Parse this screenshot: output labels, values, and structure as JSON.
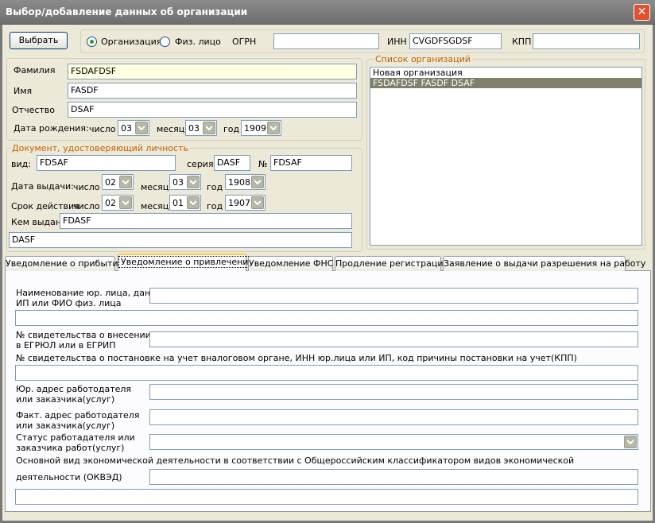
{
  "window": {
    "title": "Выбор/добавление данных об организации",
    "close": "✕"
  },
  "toolbar": {
    "select_button": "Выбрать",
    "radio_org": "Организация",
    "radio_person": "Физ. лицо",
    "ogrn_label": "ОГРН",
    "ogrn_value": "",
    "inn_label": "ИНН",
    "inn_value": "CVGDFSGDSF",
    "kpp_label": "КПП",
    "kpp_value": ""
  },
  "person": {
    "surname_label": "Фамилия",
    "surname_value": "FSDAFDSF",
    "name_label": "Имя",
    "name_value": "FASDF",
    "patronymic_label": "Отчество",
    "patronymic_value": "DSAF",
    "birth_label": "Дата рождения:",
    "day_label": "число",
    "day_value": "03",
    "month_label": "месяц",
    "month_value": "03",
    "year_label": "год",
    "year_value": "1909"
  },
  "org_list": {
    "legend": "Список организаций",
    "items": [
      "Новая организация",
      "FSDAFDSF FASDF DSAF"
    ]
  },
  "document": {
    "legend": "Документ, удостоверяющий личность",
    "type_label": "вид:",
    "type_value": "FDSAF",
    "series_label": "серия",
    "series_value": "DASF",
    "number_label": "№",
    "number_value": "FDSAF",
    "issue_label": "Дата выдачи:",
    "issue_day_label": "число",
    "issue_day": "02",
    "issue_month_label": "месяц",
    "issue_month": "03",
    "issue_year_label": "год",
    "issue_year": "1908",
    "valid_label": "Срок действия",
    "valid_day_label": "число",
    "valid_day": "02",
    "valid_month_label": "месяц",
    "valid_month": "01",
    "valid_year_label": "год",
    "valid_year": "1907",
    "issued_by_label": "Кем выдан:",
    "issued_by_value": "FDASF",
    "issued_by_value2": "DASF"
  },
  "tabs": [
    {
      "label": "Уведомление о прибытии"
    },
    {
      "label": "Уведомление  о привлечении"
    },
    {
      "label": "Уведомление ФНС"
    },
    {
      "label": "Продление регистрации"
    },
    {
      "label": "Заявление о выдачи разрешения на работу"
    }
  ],
  "form": {
    "org_name_label1": "Наименование юр. лица, данные",
    "org_name_label2": "ИП или ФИО физ. лица",
    "cert_label1": "№ свидетельства о внесении",
    "cert_label2": "в ЕГРЮЛ или в ЕГРИП",
    "tax_label": "№ свидетельства о постановке на учет вналоговом органе, ИНН юр.лица или ИП, код причины постановки на учет(КПП)",
    "legal_addr_label1": "Юр. адрес работодателя",
    "legal_addr_label2": "или заказчика(услуг)",
    "actual_addr_label1": "Факт. адрес работодателя",
    "actual_addr_label2": "или заказчика(услуг)",
    "status_label1": "Статус работадателя или",
    "status_label2": "заказчика работ(услуг)",
    "okved_label1": "Основной вид экономической деятельности в соответствии с Общероссийским классификатором видов экономической",
    "okved_label2": "деятельности (ОКВЭД)"
  }
}
